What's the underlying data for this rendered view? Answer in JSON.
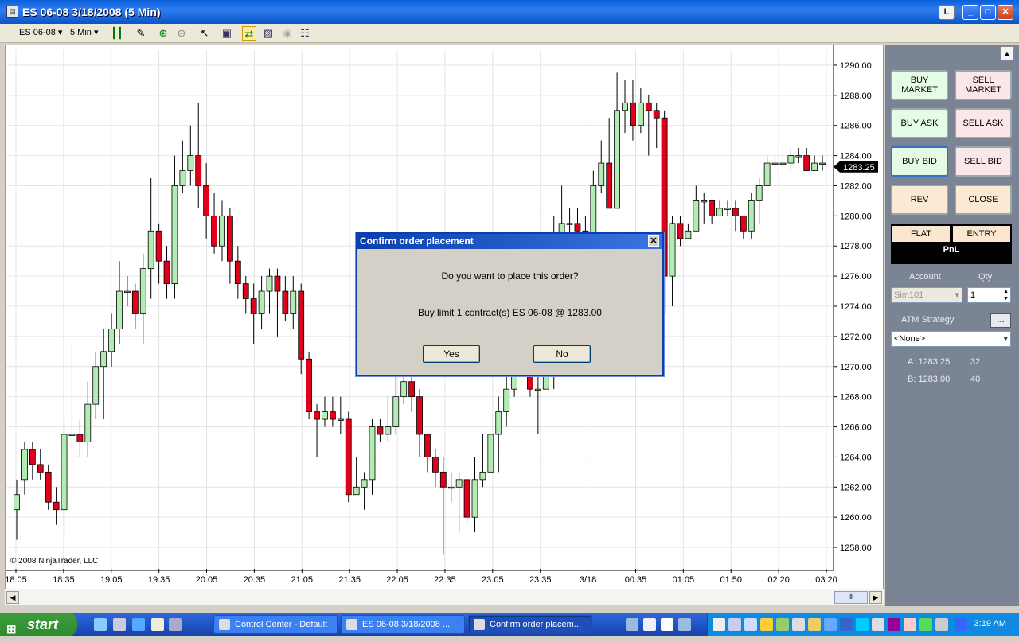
{
  "window": {
    "title": "ES 06-08  3/18/2008 (5 Min)",
    "layout_btn": "L",
    "minimize": "_",
    "maximize": "□",
    "close": "✕"
  },
  "toolbar": {
    "instrument": "ES 06-08",
    "period": "5 Min"
  },
  "chart_data": {
    "type": "candlestick",
    "instrument": "ES 06-08",
    "period": "5 Min",
    "copyright": "© 2008 NinjaTrader, LLC",
    "y_ticks": [
      "1290.00",
      "1288.00",
      "1286.00",
      "1284.00",
      "1282.00",
      "1280.00",
      "1278.00",
      "1276.00",
      "1274.00",
      "1272.00",
      "1270.00",
      "1268.00",
      "1266.00",
      "1264.00",
      "1262.00",
      "1260.00",
      "1258.00"
    ],
    "x_ticks": [
      "18:05",
      "18:35",
      "19:05",
      "19:35",
      "20:05",
      "20:35",
      "21:05",
      "21:35",
      "22:05",
      "22:35",
      "23:05",
      "23:35",
      "3/18",
      "00:35",
      "01:05",
      "01:50",
      "02:20",
      "03:20"
    ],
    "last_price": "1283.25",
    "ylim": [
      1257,
      1291
    ],
    "up_color": "#b3ecb3",
    "down_color": "#e0001a",
    "candles": [
      [
        1260.5,
        1261.5,
        1258.5,
        1262.5
      ],
      [
        1262.5,
        1264.5,
        1261.5,
        1265
      ],
      [
        1264.5,
        1263.5,
        1262.5,
        1265
      ],
      [
        1263.5,
        1263,
        1262.5,
        1264.5
      ],
      [
        1263,
        1261,
        1260.5,
        1263.5
      ],
      [
        1261,
        1260.5,
        1259.5,
        1262
      ],
      [
        1260.5,
        1265.5,
        1258.5,
        1266.5
      ],
      [
        1265.5,
        1265.5,
        1264.5,
        1271.5
      ],
      [
        1265.5,
        1265,
        1264,
        1266.5
      ],
      [
        1265,
        1267.5,
        1264,
        1269
      ],
      [
        1267.5,
        1270,
        1266.5,
        1271
      ],
      [
        1270,
        1271,
        1266.5,
        1272.5
      ],
      [
        1271,
        1272.5,
        1270,
        1273.5
      ],
      [
        1272.5,
        1275,
        1271.5,
        1277
      ],
      [
        1275,
        1275,
        1274,
        1276
      ],
      [
        1275,
        1273.5,
        1272.5,
        1275.5
      ],
      [
        1273.5,
        1276.5,
        1271.5,
        1277.5
      ],
      [
        1276.5,
        1279,
        1274.5,
        1282.5
      ],
      [
        1279,
        1277,
        1275.5,
        1279.5
      ],
      [
        1277,
        1275.5,
        1274.5,
        1278
      ],
      [
        1275.5,
        1282,
        1274.5,
        1284
      ],
      [
        1282,
        1283,
        1281.5,
        1285
      ],
      [
        1283,
        1284,
        1282,
        1286
      ],
      [
        1284,
        1282,
        1280.5,
        1287.5
      ],
      [
        1282,
        1280,
        1278.5,
        1283.5
      ],
      [
        1280,
        1278,
        1277.5,
        1281.5
      ],
      [
        1278,
        1280,
        1277,
        1281
      ],
      [
        1280,
        1277,
        1275.5,
        1280.5
      ],
      [
        1277,
        1275.5,
        1274.5,
        1278
      ],
      [
        1275.5,
        1274.5,
        1273.5,
        1276
      ],
      [
        1274.5,
        1273.5,
        1271.5,
        1275.5
      ],
      [
        1273.5,
        1275,
        1272.5,
        1276
      ],
      [
        1275,
        1276,
        1273.5,
        1276.5
      ],
      [
        1276,
        1275,
        1272,
        1276.5
      ],
      [
        1275,
        1273.5,
        1273,
        1276
      ],
      [
        1273.5,
        1275,
        1272.5,
        1276
      ],
      [
        1275,
        1270.5,
        1269.5,
        1275.5
      ],
      [
        1270.5,
        1267,
        1266.5,
        1271
      ],
      [
        1267,
        1266.5,
        1264,
        1267.5
      ],
      [
        1266.5,
        1267,
        1266,
        1268
      ],
      [
        1267,
        1266.5,
        1266,
        1268
      ],
      [
        1266.5,
        1266.5,
        1265.5,
        1268
      ],
      [
        1266.5,
        1261.5,
        1261,
        1267
      ],
      [
        1261.5,
        1262,
        1261.5,
        1264
      ],
      [
        1262,
        1262.5,
        1260.5,
        1263
      ],
      [
        1262.5,
        1266,
        1261.5,
        1266.5
      ],
      [
        1266,
        1265.5,
        1265,
        1266.5
      ],
      [
        1265.5,
        1266,
        1265,
        1268
      ],
      [
        1266,
        1268,
        1265.5,
        1269.5
      ],
      [
        1268,
        1269,
        1267.5,
        1270.5
      ],
      [
        1269,
        1268,
        1267,
        1270
      ],
      [
        1268,
        1265.5,
        1264,
        1268.5
      ],
      [
        1265.5,
        1264,
        1263,
        1265.5
      ],
      [
        1264,
        1263,
        1262,
        1264.5
      ],
      [
        1263,
        1262,
        1257.5,
        1264
      ],
      [
        1262,
        1262,
        1261,
        1263
      ],
      [
        1262,
        1262.5,
        1259,
        1263
      ],
      [
        1262.5,
        1260,
        1259.5,
        1262.5
      ],
      [
        1260,
        1262.5,
        1259,
        1264
      ],
      [
        1262.5,
        1263,
        1262,
        1265.5
      ],
      [
        1263,
        1265.5,
        1264.5,
        1265.5
      ],
      [
        1265.5,
        1267,
        1263,
        1268
      ],
      [
        1267,
        1268.5,
        1266,
        1269.5
      ],
      [
        1268.5,
        1271,
        1268,
        1272
      ],
      [
        1271,
        1270.5,
        1270,
        1272
      ],
      [
        1270.5,
        1268.5,
        1268,
        1271
      ],
      [
        1268.5,
        1268.5,
        1265.5,
        1269.5
      ],
      [
        1268.5,
        1269.5,
        1268.5,
        1270.5
      ],
      [
        1269.5,
        1278.5,
        1268.5,
        1280
      ],
      [
        1278.5,
        1279.5,
        1277.5,
        1282
      ],
      [
        1279.5,
        1279.5,
        1278.5,
        1280.5
      ],
      [
        1279.5,
        1279,
        1278.5,
        1280.5
      ],
      [
        1279,
        1278.5,
        1277.5,
        1280
      ],
      [
        1278.5,
        1282,
        1277.5,
        1283
      ],
      [
        1282,
        1283.5,
        1281.5,
        1285
      ],
      [
        1283.5,
        1280.5,
        1280.5,
        1286.5
      ],
      [
        1280.5,
        1287,
        1280.5,
        1289.5
      ],
      [
        1287,
        1287.5,
        1285.5,
        1289
      ],
      [
        1287.5,
        1286,
        1285,
        1289
      ],
      [
        1286,
        1287.5,
        1285.5,
        1288.5
      ],
      [
        1287.5,
        1287,
        1284,
        1288
      ],
      [
        1287,
        1286.5,
        1284.5,
        1287.5
      ],
      [
        1286.5,
        1276,
        1273.5,
        1287
      ],
      [
        1276,
        1279.5,
        1274,
        1280
      ],
      [
        1279.5,
        1278.5,
        1278,
        1280
      ],
      [
        1278.5,
        1279,
        1278.5,
        1279.5
      ],
      [
        1279,
        1281,
        1280,
        1282
      ],
      [
        1281,
        1281,
        1279.5,
        1281.5
      ],
      [
        1281,
        1280,
        1279.5,
        1281
      ],
      [
        1280,
        1280.5,
        1280,
        1281
      ],
      [
        1280.5,
        1280.5,
        1280,
        1281
      ],
      [
        1280.5,
        1280,
        1279,
        1281
      ],
      [
        1280,
        1279,
        1278.5,
        1280
      ],
      [
        1279,
        1281,
        1278.5,
        1281.5
      ],
      [
        1281,
        1282,
        1279.5,
        1282.5
      ],
      [
        1282,
        1283.5,
        1282,
        1284
      ],
      [
        1283.5,
        1283.5,
        1283,
        1284
      ],
      [
        1283.5,
        1283.5,
        1283,
        1284.5
      ],
      [
        1283.5,
        1284,
        1283,
        1284.5
      ],
      [
        1284,
        1284,
        1283.5,
        1284.5
      ],
      [
        1284,
        1283,
        1283,
        1284.5
      ],
      [
        1283,
        1283.5,
        1283,
        1284
      ],
      [
        1283.5,
        1283.5,
        1283,
        1284
      ]
    ]
  },
  "side": {
    "buy_market": "BUY MARKET",
    "sell_market": "SELL MARKET",
    "buy_ask": "BUY ASK",
    "sell_ask": "SELL ASK",
    "buy_bid": "BUY BID",
    "sell_bid": "SELL BID",
    "rev": "REV",
    "close": "CLOSE",
    "flat": "FLAT",
    "entry": "ENTRY",
    "pnl": "PnL",
    "account_label": "Account",
    "account_value": "Sim101",
    "qty_label": "Qty",
    "qty_value": "1",
    "atm_label": "ATM Strategy",
    "atm_btn": "...",
    "atm_value": "<None>",
    "ask_label": "A: 1283.25",
    "ask_size": "32",
    "bid_label": "B: 1283.00",
    "bid_size": "40"
  },
  "dialog": {
    "title": "Confirm order placement",
    "question": "Do you want to place this order?",
    "detail": "Buy limit 1 contract(s) ES 06-08 @ 1283.00",
    "yes": "Yes",
    "no": "No"
  },
  "taskbar": {
    "start": "start",
    "tasks": [
      "Control Center - Default",
      "ES 06-08  3/18/2008 ...",
      "Confirm order placem..."
    ],
    "clock": "3:19 AM"
  }
}
